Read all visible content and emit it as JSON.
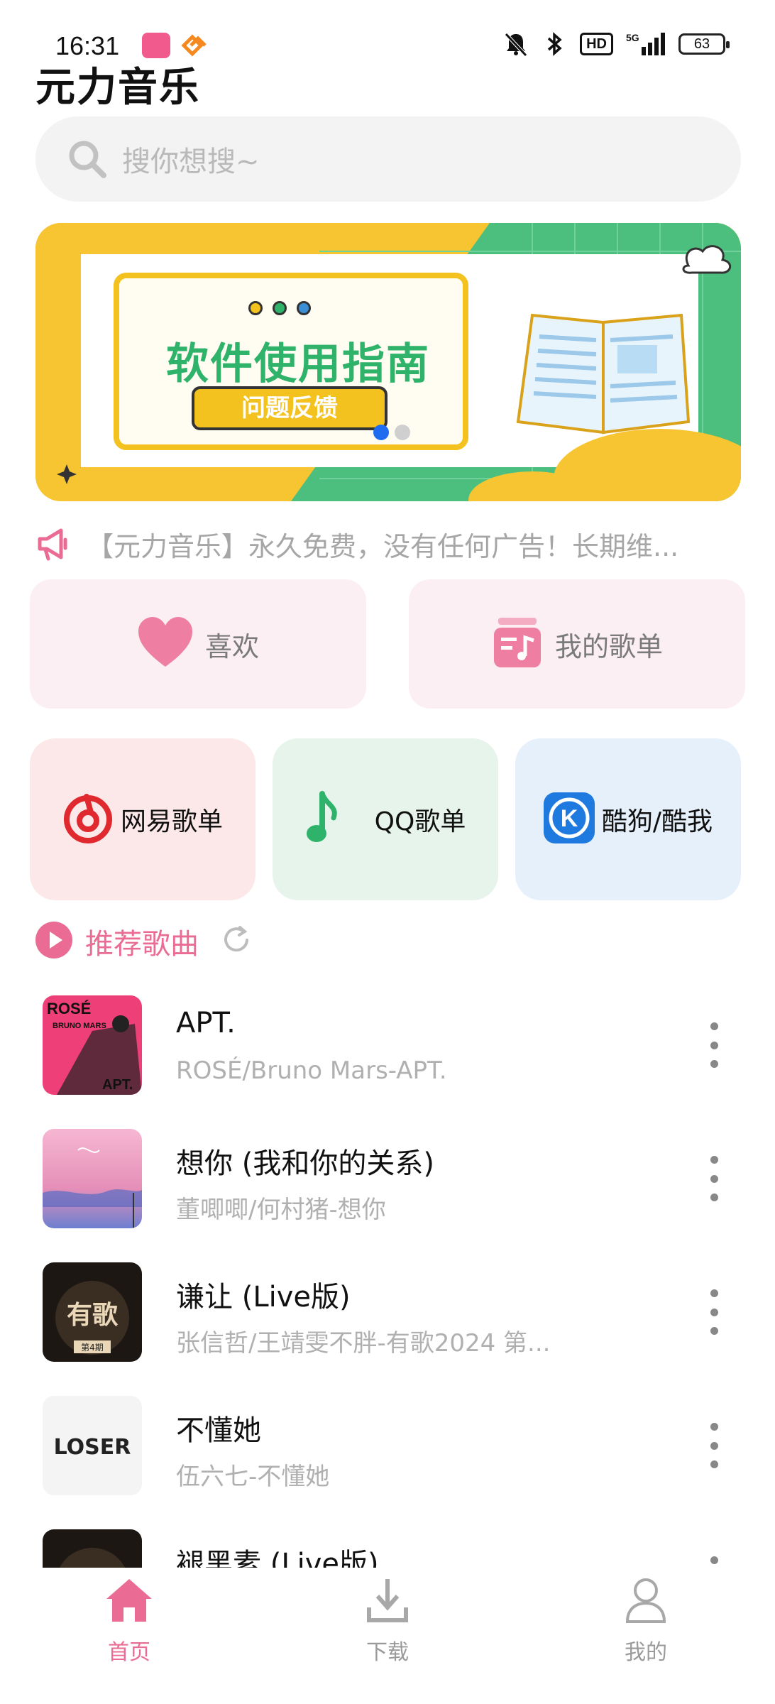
{
  "status_bar": {
    "time": "16:31",
    "hd": "HD",
    "network": "5G",
    "battery": "63"
  },
  "app": {
    "title": "元力音乐"
  },
  "search": {
    "placeholder": "搜你想搜~"
  },
  "banner": {
    "title": "软件使用指南",
    "button": "问题反馈",
    "pages": 2,
    "active_page": 1
  },
  "notice": {
    "text": "【元力音乐】永久免费，没有任何广告！长期维..."
  },
  "quick": {
    "like": "喜欢",
    "my_playlists": "我的歌单"
  },
  "sources": [
    {
      "label": "网易歌单",
      "icon": "netease-icon",
      "color": "#e0282f"
    },
    {
      "label": "QQ歌单",
      "icon": "qq-music-icon",
      "color": "#2fb36b"
    },
    {
      "label": "酷狗/酷我",
      "icon": "kugou-icon",
      "color": "#1f7ae0"
    }
  ],
  "recommend": {
    "title": "推荐歌曲"
  },
  "songs": [
    {
      "title": "APT.",
      "subtitle": "ROSÉ/Bruno Mars-APT."
    },
    {
      "title": "想你 (我和你的关系)",
      "subtitle": "董唧唧/何村猪-想你"
    },
    {
      "title": "谦让 (Live版)",
      "subtitle": "张信哲/王靖雯不胖-有歌2024 第..."
    },
    {
      "title": "不懂她",
      "subtitle": "伍六七-不懂她"
    },
    {
      "title": "褪黑素 (Live版)",
      "subtitle": ""
    }
  ],
  "covers": {
    "apt_text": "ROSÉ",
    "apt_sub": "BRUNO MARS",
    "apt_corner": "APT.",
    "youge_text": "有歌",
    "youge_sub": "第4期",
    "loser_text": "LOSER"
  },
  "nav": {
    "home": "首页",
    "download": "下载",
    "mine": "我的"
  },
  "colors": {
    "accent": "#ea6b93",
    "banner_yellow": "#f7c531",
    "banner_green": "#4cbf7f"
  }
}
